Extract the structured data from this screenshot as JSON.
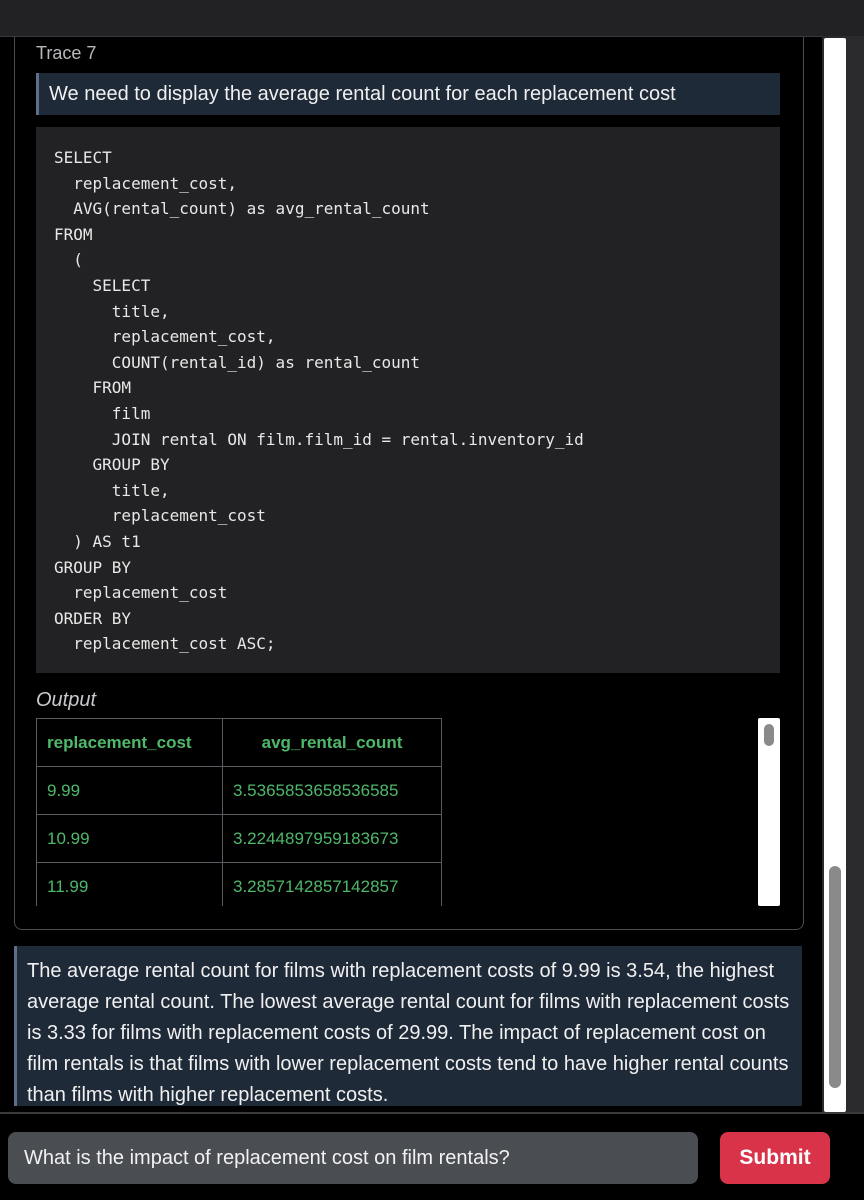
{
  "trace": {
    "title": "Trace 7",
    "question": "We need to display the average rental count for each replacement cost",
    "sql": "SELECT\n  replacement_cost,\n  AVG(rental_count) as avg_rental_count\nFROM\n  (\n    SELECT\n      title,\n      replacement_cost,\n      COUNT(rental_id) as rental_count\n    FROM\n      film\n      JOIN rental ON film.film_id = rental.inventory_id\n    GROUP BY\n      title,\n      replacement_cost\n  ) AS t1\nGROUP BY\n  replacement_cost\nORDER BY\n  replacement_cost ASC;",
    "output_label": "Output",
    "table": {
      "headers": [
        "replacement_cost",
        "avg_rental_count"
      ],
      "rows": [
        [
          "9.99",
          "3.5365853658536585"
        ],
        [
          "10.99",
          "3.2244897959183673"
        ],
        [
          "11.99",
          "3.2857142857142857"
        ]
      ]
    }
  },
  "answer": "The average rental count for films with replacement costs of 9.99 is 3.54, the highest average rental count. The lowest average rental count for films with replacement costs is 3.33 for films with replacement costs of 29.99. The impact of replacement cost on film rentals is that films with lower replacement costs tend to have higher rental counts than films with higher replacement costs.",
  "input": {
    "value": "What is the impact of replacement cost on film rentals?",
    "submit_label": "Submit"
  },
  "colors": {
    "output_text": "#4fb86a",
    "submit": "#d9334a",
    "highlight_box": "#1f2a38"
  }
}
